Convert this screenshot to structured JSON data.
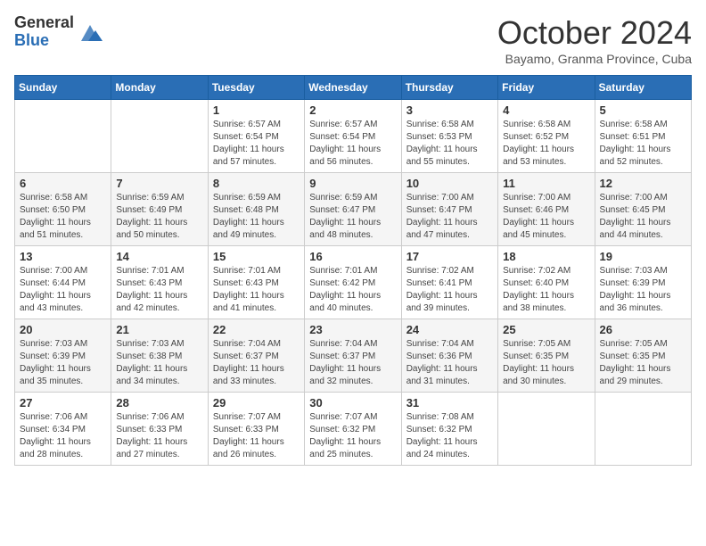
{
  "logo": {
    "general": "General",
    "blue": "Blue"
  },
  "header": {
    "month": "October 2024",
    "subtitle": "Bayamo, Granma Province, Cuba"
  },
  "weekdays": [
    "Sunday",
    "Monday",
    "Tuesday",
    "Wednesday",
    "Thursday",
    "Friday",
    "Saturday"
  ],
  "weeks": [
    [
      {
        "day": "",
        "detail": ""
      },
      {
        "day": "",
        "detail": ""
      },
      {
        "day": "1",
        "detail": "Sunrise: 6:57 AM\nSunset: 6:54 PM\nDaylight: 11 hours and 57 minutes."
      },
      {
        "day": "2",
        "detail": "Sunrise: 6:57 AM\nSunset: 6:54 PM\nDaylight: 11 hours and 56 minutes."
      },
      {
        "day": "3",
        "detail": "Sunrise: 6:58 AM\nSunset: 6:53 PM\nDaylight: 11 hours and 55 minutes."
      },
      {
        "day": "4",
        "detail": "Sunrise: 6:58 AM\nSunset: 6:52 PM\nDaylight: 11 hours and 53 minutes."
      },
      {
        "day": "5",
        "detail": "Sunrise: 6:58 AM\nSunset: 6:51 PM\nDaylight: 11 hours and 52 minutes."
      }
    ],
    [
      {
        "day": "6",
        "detail": "Sunrise: 6:58 AM\nSunset: 6:50 PM\nDaylight: 11 hours and 51 minutes."
      },
      {
        "day": "7",
        "detail": "Sunrise: 6:59 AM\nSunset: 6:49 PM\nDaylight: 11 hours and 50 minutes."
      },
      {
        "day": "8",
        "detail": "Sunrise: 6:59 AM\nSunset: 6:48 PM\nDaylight: 11 hours and 49 minutes."
      },
      {
        "day": "9",
        "detail": "Sunrise: 6:59 AM\nSunset: 6:47 PM\nDaylight: 11 hours and 48 minutes."
      },
      {
        "day": "10",
        "detail": "Sunrise: 7:00 AM\nSunset: 6:47 PM\nDaylight: 11 hours and 47 minutes."
      },
      {
        "day": "11",
        "detail": "Sunrise: 7:00 AM\nSunset: 6:46 PM\nDaylight: 11 hours and 45 minutes."
      },
      {
        "day": "12",
        "detail": "Sunrise: 7:00 AM\nSunset: 6:45 PM\nDaylight: 11 hours and 44 minutes."
      }
    ],
    [
      {
        "day": "13",
        "detail": "Sunrise: 7:00 AM\nSunset: 6:44 PM\nDaylight: 11 hours and 43 minutes."
      },
      {
        "day": "14",
        "detail": "Sunrise: 7:01 AM\nSunset: 6:43 PM\nDaylight: 11 hours and 42 minutes."
      },
      {
        "day": "15",
        "detail": "Sunrise: 7:01 AM\nSunset: 6:43 PM\nDaylight: 11 hours and 41 minutes."
      },
      {
        "day": "16",
        "detail": "Sunrise: 7:01 AM\nSunset: 6:42 PM\nDaylight: 11 hours and 40 minutes."
      },
      {
        "day": "17",
        "detail": "Sunrise: 7:02 AM\nSunset: 6:41 PM\nDaylight: 11 hours and 39 minutes."
      },
      {
        "day": "18",
        "detail": "Sunrise: 7:02 AM\nSunset: 6:40 PM\nDaylight: 11 hours and 38 minutes."
      },
      {
        "day": "19",
        "detail": "Sunrise: 7:03 AM\nSunset: 6:39 PM\nDaylight: 11 hours and 36 minutes."
      }
    ],
    [
      {
        "day": "20",
        "detail": "Sunrise: 7:03 AM\nSunset: 6:39 PM\nDaylight: 11 hours and 35 minutes."
      },
      {
        "day": "21",
        "detail": "Sunrise: 7:03 AM\nSunset: 6:38 PM\nDaylight: 11 hours and 34 minutes."
      },
      {
        "day": "22",
        "detail": "Sunrise: 7:04 AM\nSunset: 6:37 PM\nDaylight: 11 hours and 33 minutes."
      },
      {
        "day": "23",
        "detail": "Sunrise: 7:04 AM\nSunset: 6:37 PM\nDaylight: 11 hours and 32 minutes."
      },
      {
        "day": "24",
        "detail": "Sunrise: 7:04 AM\nSunset: 6:36 PM\nDaylight: 11 hours and 31 minutes."
      },
      {
        "day": "25",
        "detail": "Sunrise: 7:05 AM\nSunset: 6:35 PM\nDaylight: 11 hours and 30 minutes."
      },
      {
        "day": "26",
        "detail": "Sunrise: 7:05 AM\nSunset: 6:35 PM\nDaylight: 11 hours and 29 minutes."
      }
    ],
    [
      {
        "day": "27",
        "detail": "Sunrise: 7:06 AM\nSunset: 6:34 PM\nDaylight: 11 hours and 28 minutes."
      },
      {
        "day": "28",
        "detail": "Sunrise: 7:06 AM\nSunset: 6:33 PM\nDaylight: 11 hours and 27 minutes."
      },
      {
        "day": "29",
        "detail": "Sunrise: 7:07 AM\nSunset: 6:33 PM\nDaylight: 11 hours and 26 minutes."
      },
      {
        "day": "30",
        "detail": "Sunrise: 7:07 AM\nSunset: 6:32 PM\nDaylight: 11 hours and 25 minutes."
      },
      {
        "day": "31",
        "detail": "Sunrise: 7:08 AM\nSunset: 6:32 PM\nDaylight: 11 hours and 24 minutes."
      },
      {
        "day": "",
        "detail": ""
      },
      {
        "day": "",
        "detail": ""
      }
    ]
  ]
}
